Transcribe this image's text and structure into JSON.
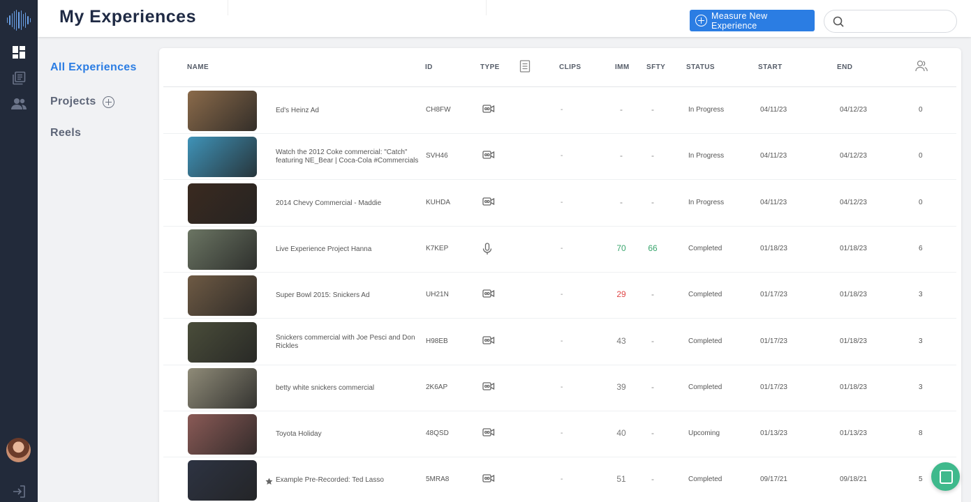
{
  "app": {
    "title": "My Experiences",
    "accent": "#2b7de3",
    "green": "#3aa66e",
    "red": "#e04848"
  },
  "rail": {
    "icons": [
      "logo-waveform-icon",
      "dashboard-icon",
      "library-icon",
      "users-icon",
      "avatar",
      "logout-icon"
    ]
  },
  "header": {
    "measure_label": "Measure New Experience",
    "search_placeholder": ""
  },
  "sidebar": {
    "items": [
      {
        "label": "All Experiences"
      },
      {
        "label": "Projects"
      },
      {
        "label": "Reels"
      }
    ]
  },
  "table": {
    "columns": {
      "name": "NAME",
      "id": "ID",
      "type": "TYPE",
      "clips": "CLIPS",
      "imm": "IMM",
      "sfty": "SFTY",
      "status": "STATUS",
      "start": "START",
      "end": "END"
    },
    "rows": [
      {
        "name": "Ed's Heinz Ad",
        "id": "CH8FW",
        "type": "video",
        "clips": "-",
        "imm": "-",
        "imm_color": "#888888",
        "sfty": "-",
        "sfty_color": "#888888",
        "status": "In Progress",
        "start": "04/11/23",
        "end": "04/12/23",
        "count": "0",
        "starred": false,
        "thumb": "#8a6a4a"
      },
      {
        "name": "Watch the 2012 Coke commercial: \"Catch\" featuring NE_Bear | Coca-Cola #Commercials",
        "id": "SVH46",
        "type": "video",
        "clips": "-",
        "imm": "-",
        "imm_color": "#888888",
        "sfty": "-",
        "sfty_color": "#888888",
        "status": "In Progress",
        "start": "04/11/23",
        "end": "04/12/23",
        "count": "0",
        "starred": false,
        "thumb": "#3f93b8"
      },
      {
        "name": "2014 Chevy Commercial - Maddie",
        "id": "KUHDA",
        "type": "video",
        "clips": "-",
        "imm": "-",
        "imm_color": "#888888",
        "sfty": "-",
        "sfty_color": "#888888",
        "status": "In Progress",
        "start": "04/11/23",
        "end": "04/12/23",
        "count": "0",
        "starred": false,
        "thumb": "#3a2a20"
      },
      {
        "name": "Live Experience Project Hanna",
        "id": "K7KEP",
        "type": "audio",
        "clips": "-",
        "imm": "70",
        "imm_color": "#3aa66e",
        "sfty": "66",
        "sfty_color": "#3aa66e",
        "status": "Completed",
        "start": "01/18/23",
        "end": "01/18/23",
        "count": "6",
        "starred": false,
        "thumb": "#6b7563"
      },
      {
        "name": "Super Bowl 2015: Snickers Ad",
        "id": "UH21N",
        "type": "video",
        "clips": "-",
        "imm": "29",
        "imm_color": "#e04848",
        "sfty": "-",
        "sfty_color": "#888888",
        "status": "Completed",
        "start": "01/17/23",
        "end": "01/18/23",
        "count": "3",
        "starred": false,
        "thumb": "#6e5a44"
      },
      {
        "name": "Snickers commercial with Joe Pesci and Don Rickles",
        "id": "H98EB",
        "type": "video",
        "clips": "-",
        "imm": "43",
        "imm_color": "#777777",
        "sfty": "-",
        "sfty_color": "#888888",
        "status": "Completed",
        "start": "01/17/23",
        "end": "01/18/23",
        "count": "3",
        "starred": false,
        "thumb": "#4a4d3a"
      },
      {
        "name": "betty white snickers commercial",
        "id": "2K6AP",
        "type": "video",
        "clips": "-",
        "imm": "39",
        "imm_color": "#777777",
        "sfty": "-",
        "sfty_color": "#888888",
        "status": "Completed",
        "start": "01/17/23",
        "end": "01/18/23",
        "count": "3",
        "starred": false,
        "thumb": "#8f8b78"
      },
      {
        "name": "Toyota Holiday",
        "id": "48QSD",
        "type": "video",
        "clips": "-",
        "imm": "40",
        "imm_color": "#777777",
        "sfty": "-",
        "sfty_color": "#888888",
        "status": "Upcoming",
        "start": "01/13/23",
        "end": "01/13/23",
        "count": "8",
        "starred": false,
        "thumb": "#8a5a56"
      },
      {
        "name": "Example Pre-Recorded: Ted Lasso",
        "id": "5MRA8",
        "type": "video",
        "clips": "-",
        "imm": "51",
        "imm_color": "#777777",
        "sfty": "-",
        "sfty_color": "#888888",
        "status": "Completed",
        "start": "09/17/21",
        "end": "09/18/21",
        "count": "5",
        "starred": true,
        "thumb": "#2d3342"
      }
    ]
  }
}
